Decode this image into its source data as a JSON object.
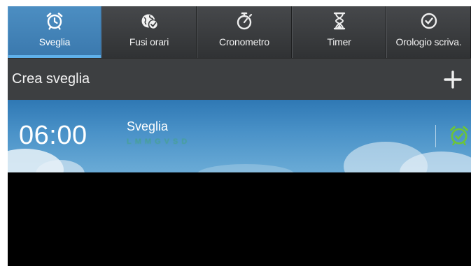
{
  "tabs": [
    {
      "label": "Sveglia",
      "icon": "alarm-clock-icon",
      "active": true
    },
    {
      "label": "Fusi orari",
      "icon": "world-clock-icon",
      "active": false
    },
    {
      "label": "Cronometro",
      "icon": "stopwatch-icon",
      "active": false
    },
    {
      "label": "Timer",
      "icon": "hourglass-icon",
      "active": false
    },
    {
      "label": "Orologio scriva.",
      "icon": "desk-clock-icon",
      "active": false
    }
  ],
  "create": {
    "title": "Crea sveglia",
    "add_icon": "plus-icon"
  },
  "alarms": [
    {
      "time": "06:00",
      "name": "Sveglia",
      "days": [
        "L",
        "M",
        "M",
        "G",
        "V",
        "S",
        "D"
      ],
      "days_color": "#3fa86a",
      "enabled": true,
      "toggle_icon": "alarm-clock-icon",
      "toggle_color": "#6cc43a"
    }
  ],
  "colors": {
    "accent": "#4c8ec2",
    "tabbar": "#3a3c3e",
    "header": "#3d3f41"
  }
}
